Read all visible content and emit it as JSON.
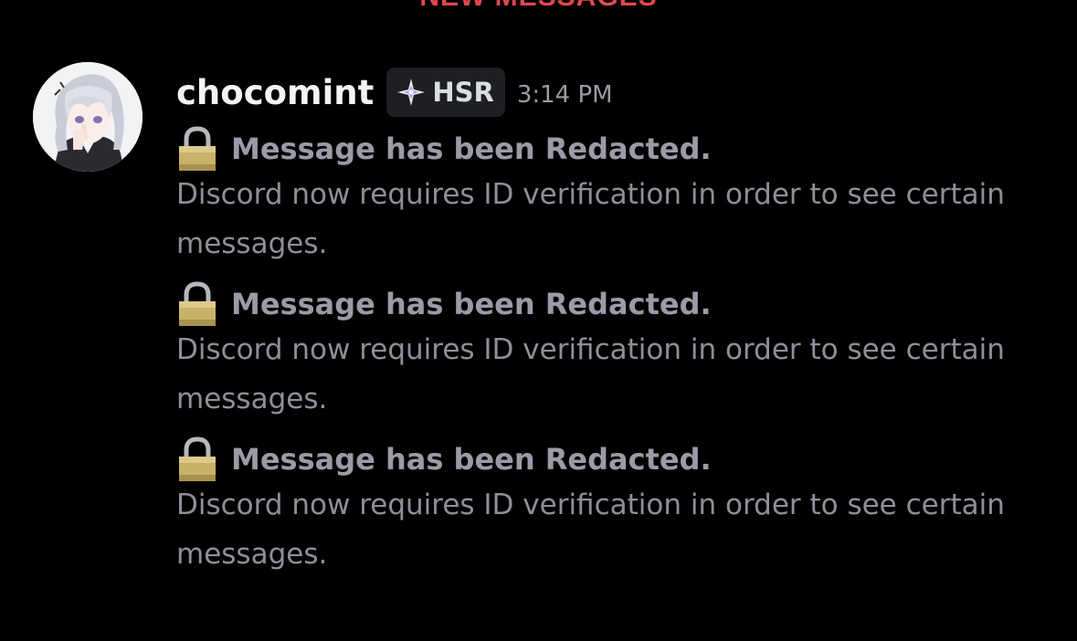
{
  "divider": {
    "label": "NEW MESSAGES"
  },
  "author": {
    "username": "chocomint",
    "tag": "HSR",
    "tag_icon": "sparkle-icon",
    "timestamp": "3:14 PM"
  },
  "messages": [
    {
      "icon": "lock-icon",
      "title": "Message has been Redacted.",
      "body": "Discord now requires ID verification in order to see certain messages."
    },
    {
      "icon": "lock-icon",
      "title": "Message has been Redacted.",
      "body": "Discord now requires ID verification in order to see certain messages."
    },
    {
      "icon": "lock-icon",
      "title": "Message has been Redacted.",
      "body": "Discord now requires ID verification in order to see certain messages."
    }
  ],
  "colors": {
    "background": "#000000",
    "divider": "#e0484f",
    "username": "#f2f3f5",
    "tag_bg": "#1e1f22",
    "tag_text": "#dbdee1",
    "timestamp": "#9a9ca3",
    "message_title": "#9a9ba6",
    "message_body": "#8e8f97"
  }
}
